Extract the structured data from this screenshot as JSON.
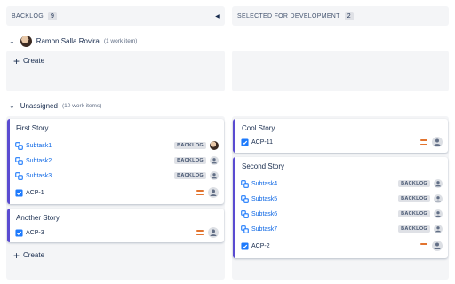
{
  "columns": [
    {
      "name": "BACKLOG",
      "count": "9",
      "collapse_icon": "triangle-left-icon"
    },
    {
      "name": "SELECTED FOR DEVELOPMENT",
      "count": "2"
    }
  ],
  "swimlanes": [
    {
      "name": "Ramon Salla Rovira",
      "count": "(1 work item)"
    },
    {
      "name": "Unassigned",
      "count": "(10 work items)"
    }
  ],
  "create_label": "Create",
  "cards": {
    "first_story": {
      "title": "First Story",
      "subtasks": [
        {
          "label": "Subtask1",
          "status": "BACKLOG"
        },
        {
          "label": "Subtask2",
          "status": "BACKLOG"
        },
        {
          "label": "Subtask3",
          "status": "BACKLOG"
        }
      ],
      "key": "ACP-1"
    },
    "another_story": {
      "title": "Another Story",
      "key": "ACP-3"
    },
    "cool_story": {
      "title": "Cool Story",
      "key": "ACP-11"
    },
    "second_story": {
      "title": "Second Story",
      "subtasks": [
        {
          "label": "Subtask4",
          "status": "BACKLOG"
        },
        {
          "label": "Subtask5",
          "status": "BACKLOG"
        },
        {
          "label": "Subtask6",
          "status": "BACKLOG"
        },
        {
          "label": "Subtask7",
          "status": "BACKLOG"
        }
      ],
      "key": "ACP-2"
    }
  },
  "colors": {
    "accent": "#5a4bd1",
    "link": "#0c66e4",
    "priority": "#e2742f",
    "task": "#1d7afc"
  }
}
